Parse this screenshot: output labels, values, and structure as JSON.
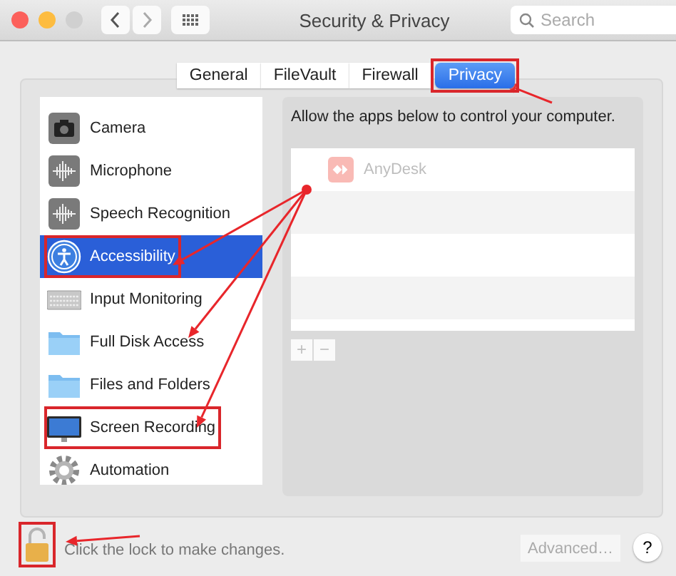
{
  "window": {
    "title": "Security & Privacy"
  },
  "search": {
    "placeholder": "Search"
  },
  "tabs": [
    {
      "label": "General",
      "selected": false,
      "highlighted": false
    },
    {
      "label": "FileVault",
      "selected": false,
      "highlighted": false
    },
    {
      "label": "Firewall",
      "selected": false,
      "highlighted": false
    },
    {
      "label": "Privacy",
      "selected": true,
      "highlighted": true
    }
  ],
  "sidebar": {
    "items": [
      {
        "label": "Camera",
        "selected": false,
        "highlighted": false
      },
      {
        "label": "Microphone",
        "selected": false,
        "highlighted": false
      },
      {
        "label": "Speech Recognition",
        "selected": false,
        "highlighted": false
      },
      {
        "label": "Accessibility",
        "selected": true,
        "highlighted": true
      },
      {
        "label": "Input Monitoring",
        "selected": false,
        "highlighted": false
      },
      {
        "label": "Full Disk Access",
        "selected": false,
        "highlighted": false
      },
      {
        "label": "Files and Folders",
        "selected": false,
        "highlighted": false
      },
      {
        "label": "Screen Recording",
        "selected": false,
        "highlighted": true
      },
      {
        "label": "Automation",
        "selected": false,
        "highlighted": false
      }
    ]
  },
  "apps_panel": {
    "description": "Allow the apps below to control your computer.",
    "apps": [
      {
        "name": "AnyDesk",
        "disabled": true
      }
    ],
    "add_button": {
      "label": "+",
      "disabled": true
    },
    "remove_button": {
      "label": "−",
      "disabled": true
    }
  },
  "footer": {
    "lock_text": "Click the lock to make changes.",
    "lock_highlighted": true,
    "advanced_button": {
      "label": "Advanced…",
      "disabled": true
    },
    "help_button": {
      "label": "?"
    }
  }
}
